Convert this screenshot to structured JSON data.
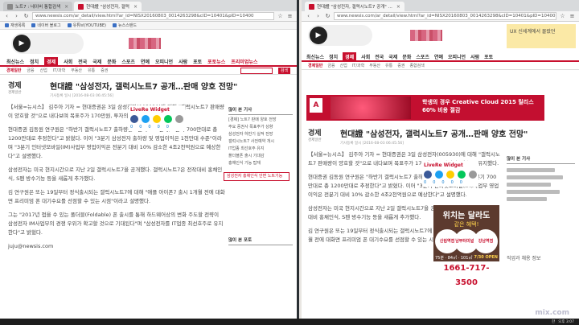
{
  "left": {
    "tabs": [
      {
        "label": "노트7 : 네이버 통합검색"
      },
      {
        "label": "현대證 \"삼성전자, 갤럭"
      }
    ],
    "url": "www.newsis.com/ar_detail/view.html?ar_id=NISX20160803_0014263298&cID=10401&pID=10400",
    "bookmarks": [
      "재생목록",
      "네이버 블로그",
      "유튜브(YOUTUBE)",
      "뉴스스탠드"
    ],
    "nav": [
      "최신뉴스",
      "정치",
      "경제",
      "사회",
      "전국",
      "국제",
      "문화",
      "스포츠",
      "연예",
      "오피니언",
      "사람",
      "포토",
      "포토뉴스",
      "프리미엄뉴스"
    ],
    "nav_active": "경제",
    "subnav": [
      "경제일반",
      "금융",
      "산업",
      "IT/과학",
      "부동산",
      "유통",
      "증권",
      "종합검색"
    ],
    "search_btn": "검색",
    "section": "경제",
    "section_sub": "경제일반",
    "headline": "현대證 \"삼성전자, 갤럭시노트7 공개…판매 양호 전망\"",
    "meta": "기사등록 일시 [2016-08-03 06:45:56]",
    "p1": "【서울=뉴시스】 김주아 기자 = 현대증권은 3일 삼성전자(005930)에 대해 \"갤럭시노트7 판매량이 양호할 것\"으로 내다보며 목표주가 170만원, 투자의견 '매수'를 유지했다.",
    "p2": "현대증권 김동원 연구원은 \"하반기 갤럭시노트7 출하량을 3분기 800만대, 4분기 700만대로 총 1200만대로 추정한다\"고 밝혔다. 이어 \"3분기 삼성전자 출하량 및 영업이익은 1천만대 수준\"이라며 \"3분기 인터넷모바일(IM)사업부 영업이익은 전분기 대비 10% 감소한 4조2천억원으로 예상한다\"고 설명했다.",
    "p3": "삼성전자는 미국 현지시간으로 지난 2일 갤럭시노트7을 공개했다. 갤럭시노트7은 전작대비 홍채인식, S펜 방수기능 등을 새롭게 추가했다.",
    "p4": "김 연구원은 또는 19일부터 정식출시되는 갤럭시노트7에 대해 \"애플 아이폰7 출시 1개월 전에 대화면 프리미엄 폰 대기수요를 선점할 수 있는 시점\"이라고 설명했다.",
    "p5": "그는 \"2017년 접을 수 있는 폴더블(Foldable) 폰 출시를 통해 하드웨어상의 변화 주도할 전략이 삼성전자 IM사업부의 경쟁 우위가 확고할 것으로 기대된다\"며 \"삼성전자를 IT업종 최선호주로 유지한다\"고 밝혔다.",
    "email": "juju@newsis.com",
    "widget": {
      "title": "LiveRe Widget",
      "counts": [
        "0",
        "0",
        "0",
        "0",
        "0"
      ]
    },
    "sidebar": {
      "title": "많이 본 기사",
      "items": [
        "[경제] 노트7 판매 양호 전망",
        "주요 증권사 목표주가 상향",
        "삼성전자 하반기 실적 전망",
        "갤럭시노트7 사전예약 개시",
        "IT업종 최선호주 유지",
        "폴더블폰 출시 기대감",
        "홍채인식 기능 탑재"
      ],
      "red": "삼성전자 홍채인식 안면 노트기능",
      "title2": "많이 본 포토"
    }
  },
  "right": {
    "tab": "현대證 \"삼성전자, 갤럭시노트7 공개\" ...",
    "url": "www.newsis.com/ar_detail/view.html?ar_id=NISX20160803_0014263298&cID=10401&pID=10400",
    "nav": [
      "최신뉴스",
      "정치",
      "경제",
      "사회",
      "전국",
      "국제",
      "문화",
      "스포츠",
      "연예",
      "오피니언",
      "사람",
      "포토"
    ],
    "nav_active": "경제",
    "subnav": [
      "경제일반",
      "금융",
      "산업",
      "IT/과학",
      "부동산",
      "유통",
      "증권",
      "종합검색"
    ],
    "ad_banner": "학생의 경우 Creative Cloud 2015 릴리스 60% 비용 절감",
    "ad_top": "UX 신세계에서 몰랐던",
    "section": "경제",
    "section_sub": "경제일반",
    "headline": "현대證 \"삼성전자, 갤럭시노트7 공개…판매 양호 전망\"",
    "meta": "기사등록 일시 [2016-08-03 06:45:56]",
    "p1": "【서울=뉴시스】 김주아 기자 = 현대증권은 3일 삼성전자(005930)에 대해 \"갤럭시노트7 판매량이 양호할 것\"으로 내다보며 목표주가 170만원, 투자의견 '매수'를 유지했다.",
    "p2": "현대증권 김동원 연구원은 \"하반기 갤럭시노트7 출하량을 3분기 800만대, 4분기 700만대로 총 1200만대로 추정한다\"고 밝혔다. 이어 \"3분기 인터넷모바일(IM)사업부 영업이익은 전분기 대비 10% 감소한 4조2천억원으로 예상한다\"고 설명했다.",
    "p3": "삼성전자는 미국 현지시간으로 지난 2일 갤럭시노트7을 공개했다. 갤럭시노트7은 전작대비 홍채인식, S펜 방수기능 등을 새롭게 추가했다.",
    "p4": "김 연구원은 또는 19일부터 정식출시되는 갤럭시노트7에 대해 \"애플 아이폰7 출시 1개월 전에 대화면 프리미엄 폰 대기수요를 선점할 수 있는 시점\"이라고 설명했다.",
    "widget": {
      "title": "LiveRe Widget",
      "counts": [
        "0",
        "0",
        "0",
        "0",
        "0"
      ]
    },
    "ad_side": {
      "title": "위치는 달라도",
      "sub": "같은 혜택!",
      "c1": "신림역점",
      "c2": "남부터미널점",
      "c3": "강남역점",
      "hours": "75분 · 84㎡ · 101㎡",
      "open": "7/30 OPEN",
      "phone": "1661-717-3500"
    },
    "sidebar_title": "많이 본 기사",
    "bottom_label": "직업과 채용 정보"
  },
  "taskbar": {
    "time": "오후 3:07",
    "lang": "한"
  },
  "watermark": "mix.com"
}
